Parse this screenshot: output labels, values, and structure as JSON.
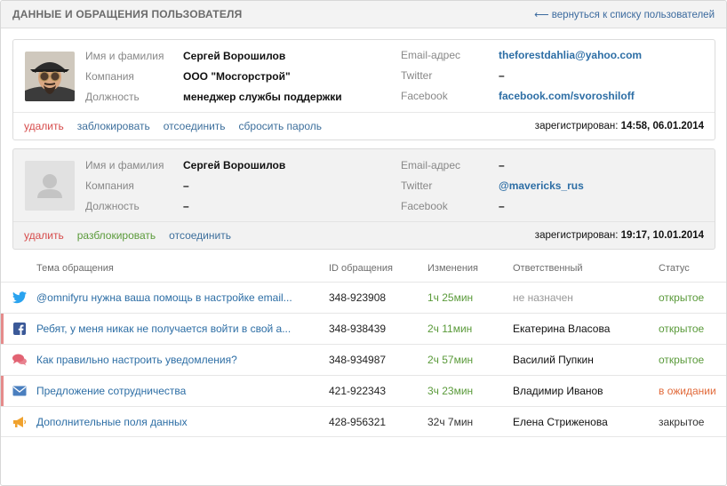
{
  "header": {
    "title": "ДАННЫЕ И ОБРАЩЕНИЯ ПОЛЬЗОВАТЕЛЯ",
    "back_link": "⟵ вернуться к списку пользователей"
  },
  "labels": {
    "name": "Имя и фамилия",
    "company": "Компания",
    "position": "Должность",
    "email": "Email-адрес",
    "twitter": "Twitter",
    "facebook": "Facebook",
    "registered": "зарегистрирован:"
  },
  "users": [
    {
      "name": "Сергей Ворошилов",
      "company": "ООО \"Мосгорстрой\"",
      "position": "менеджер службы поддержки",
      "email": "theforestdahlia@yahoo.com",
      "twitter": "–",
      "facebook": "facebook.com/svoroshiloff",
      "registered": "14:58, 06.01.2014",
      "actions": {
        "delete": "удалить",
        "block": "заблокировать",
        "disconnect": "отсоединить",
        "reset": "сбросить пароль"
      }
    },
    {
      "name": "Сергей Ворошилов",
      "company": "–",
      "position": "–",
      "email": "–",
      "twitter": "@mavericks_rus",
      "facebook": "–",
      "registered": "19:17, 10.01.2014",
      "actions": {
        "delete": "удалить",
        "unblock": "разблокировать",
        "disconnect": "отсоединить"
      }
    }
  ],
  "tickets": {
    "columns": [
      "Тема обращения",
      "ID обращения",
      "Изменения",
      "Ответственный",
      "Статус"
    ],
    "rows": [
      {
        "channel": "twitter-icon",
        "subject": "@omnifyru нужна ваша помощь в настройке email...",
        "id": "348-923908",
        "changed": "1ч 25мин",
        "assignee": "не назначен",
        "status": "открытое"
      },
      {
        "channel": "facebook-icon",
        "subject": "Ребят, у меня никак не получается войти в свой а...",
        "id": "348-938439",
        "changed": "2ч 11мин",
        "assignee": "Екатерина Власова",
        "status": "открытое"
      },
      {
        "channel": "chat-icon",
        "subject": "Как правильно настроить уведомления?",
        "id": "348-934987",
        "changed": "2ч 57мин",
        "assignee": "Василий Пупкин",
        "status": "открытое"
      },
      {
        "channel": "mail-icon",
        "subject": "Предложение сотрудничества",
        "id": "421-922343",
        "changed": "3ч 23мин",
        "assignee": "Владимир Иванов",
        "status": "в ожидании"
      },
      {
        "channel": "megaphone-icon",
        "subject": "Дополнительные поля данных",
        "id": "428-956321",
        "changed": "32ч 7мин",
        "assignee": "Елена Стриженова",
        "status": "закрытое"
      }
    ]
  },
  "colors": {
    "link": "#2d6ea5",
    "danger": "#d64b4b",
    "success": "#5a9a3a",
    "waiting": "#e16a3a",
    "twitter": "#2aa3ef",
    "facebook": "#3b5998",
    "chat": "#e26373",
    "mail": "#4a7fbf",
    "megaphone": "#f0a22e"
  }
}
